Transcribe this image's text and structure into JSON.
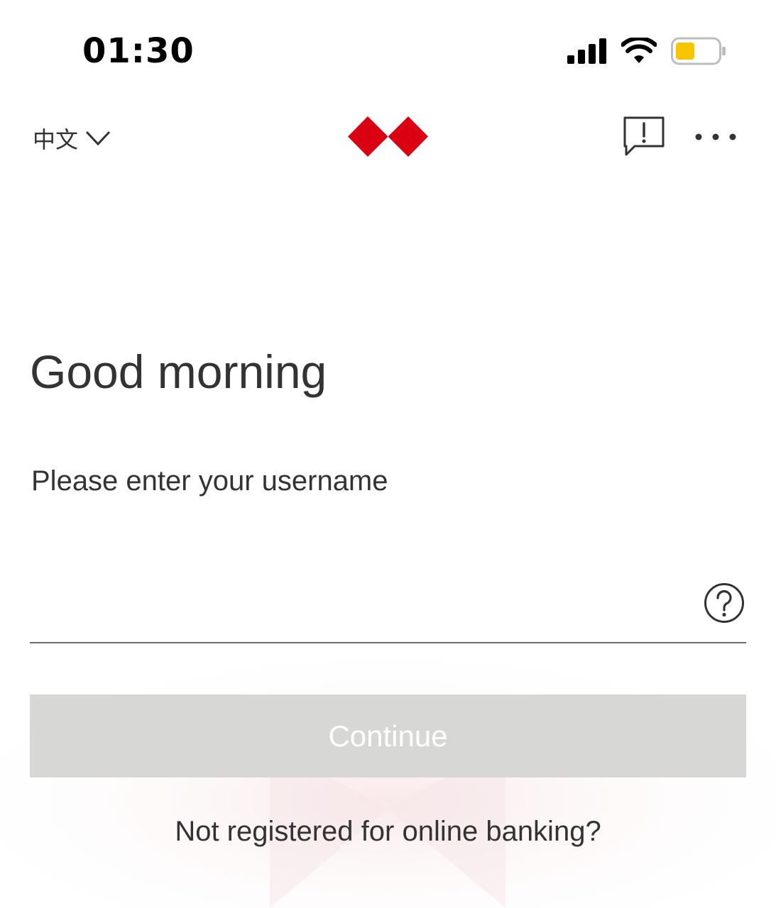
{
  "status_bar": {
    "time": "01:30",
    "icons": [
      "cellular-signal-icon",
      "wifi-icon",
      "battery-icon"
    ],
    "battery_color": "#f7c600"
  },
  "header": {
    "language_label": "中文",
    "language_chevron_icon": "chevron-down-icon",
    "logo_icon": "hsbc-hexagon-logo",
    "feedback_icon": "feedback-icon",
    "more_icon": "more-horizontal-icon"
  },
  "main": {
    "greeting": "Good morning",
    "username_label": "Please enter your username",
    "username_value": "",
    "help_icon": "help-circle-icon",
    "continue_label": "Continue",
    "register_link": "Not registered for online banking?"
  },
  "colors": {
    "brand_red": "#db0011",
    "text": "#333333",
    "button_disabled_bg": "#d7d8d6",
    "button_disabled_text": "#ffffff"
  }
}
